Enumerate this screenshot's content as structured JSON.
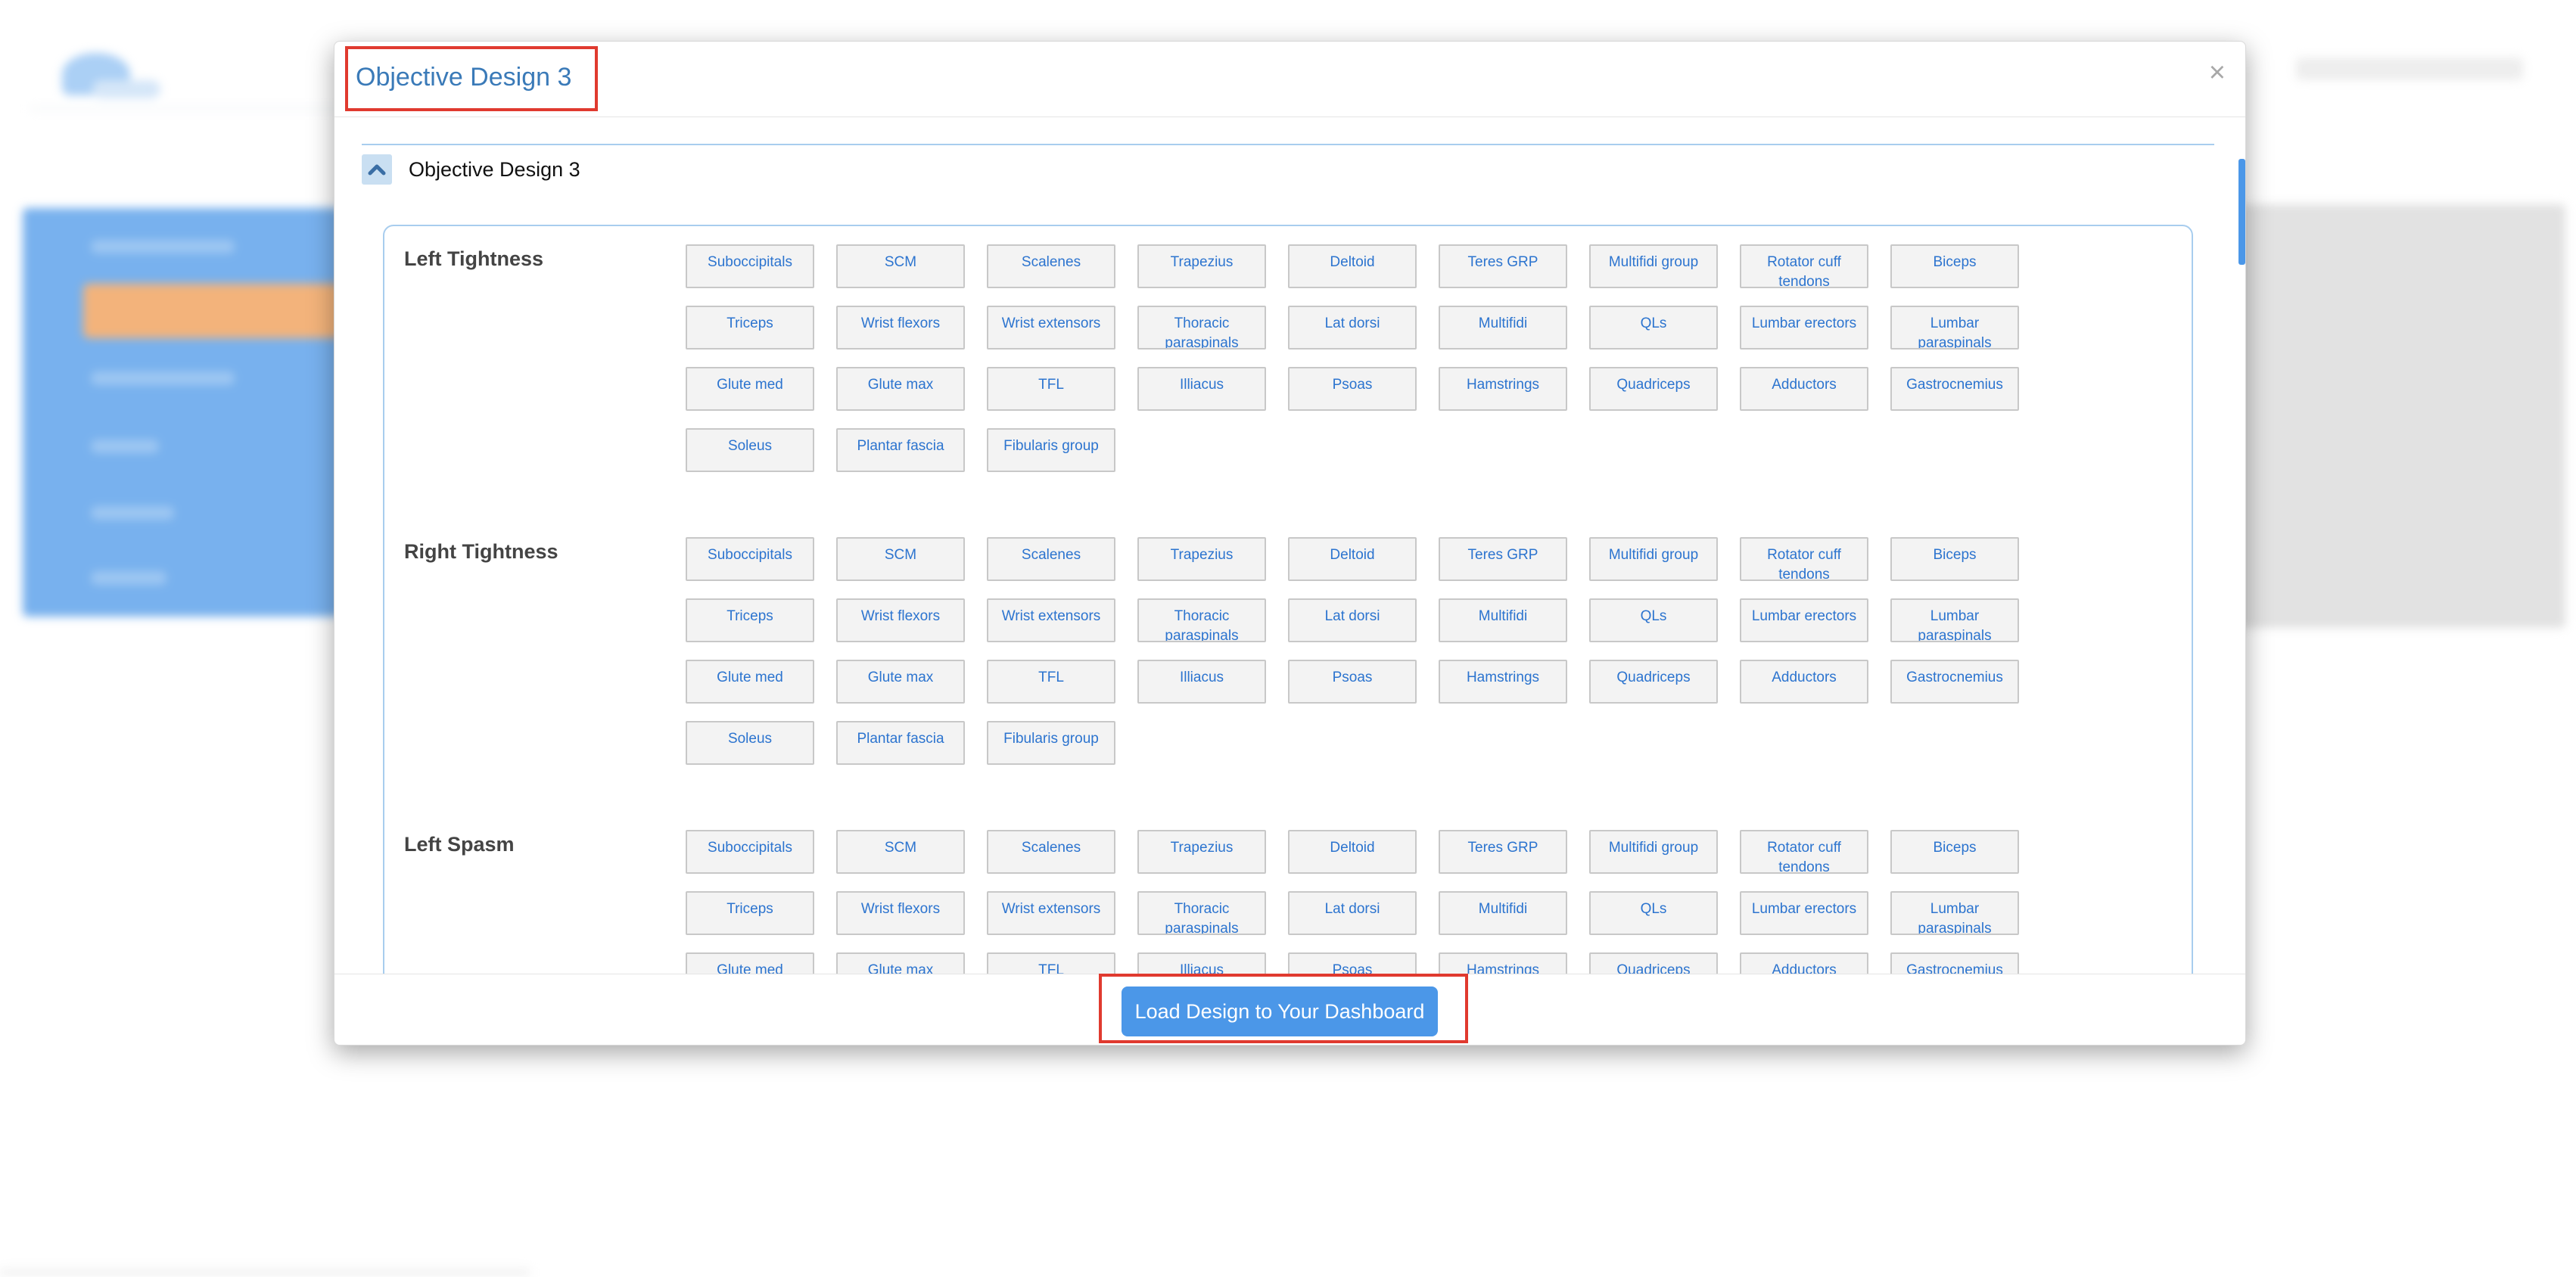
{
  "modal": {
    "title": "Objective Design 3",
    "close_label": "×",
    "accordion_title": "Objective Design 3",
    "load_button_label": "Load Design to Your Dashboard"
  },
  "muscles": [
    "Suboccipitals",
    "SCM",
    "Scalenes",
    "Trapezius",
    "Deltoid",
    "Teres GRP",
    "Multifidi group",
    "Rotator cuff tendons",
    "Biceps",
    "Triceps",
    "Wrist flexors",
    "Wrist extensors",
    "Thoracic paraspinals",
    "Lat dorsi",
    "Multifidi",
    "QLs",
    "Lumbar erectors",
    "Lumbar paraspinals",
    "Glute med",
    "Glute max",
    "TFL",
    "Illiacus",
    "Psoas",
    "Hamstrings",
    "Quadriceps",
    "Adductors",
    "Gastrocnemius",
    "Soleus",
    "Plantar fascia",
    "Fibularis group"
  ],
  "sections": [
    {
      "label": "Left Tightness"
    },
    {
      "label": "Right Tightness"
    },
    {
      "label": "Left Spasm"
    }
  ],
  "colors": {
    "accent": "#4b97e8",
    "title": "#3a7ab8",
    "highlight": "#e03a2f",
    "muscle_text": "#2c74cf"
  }
}
